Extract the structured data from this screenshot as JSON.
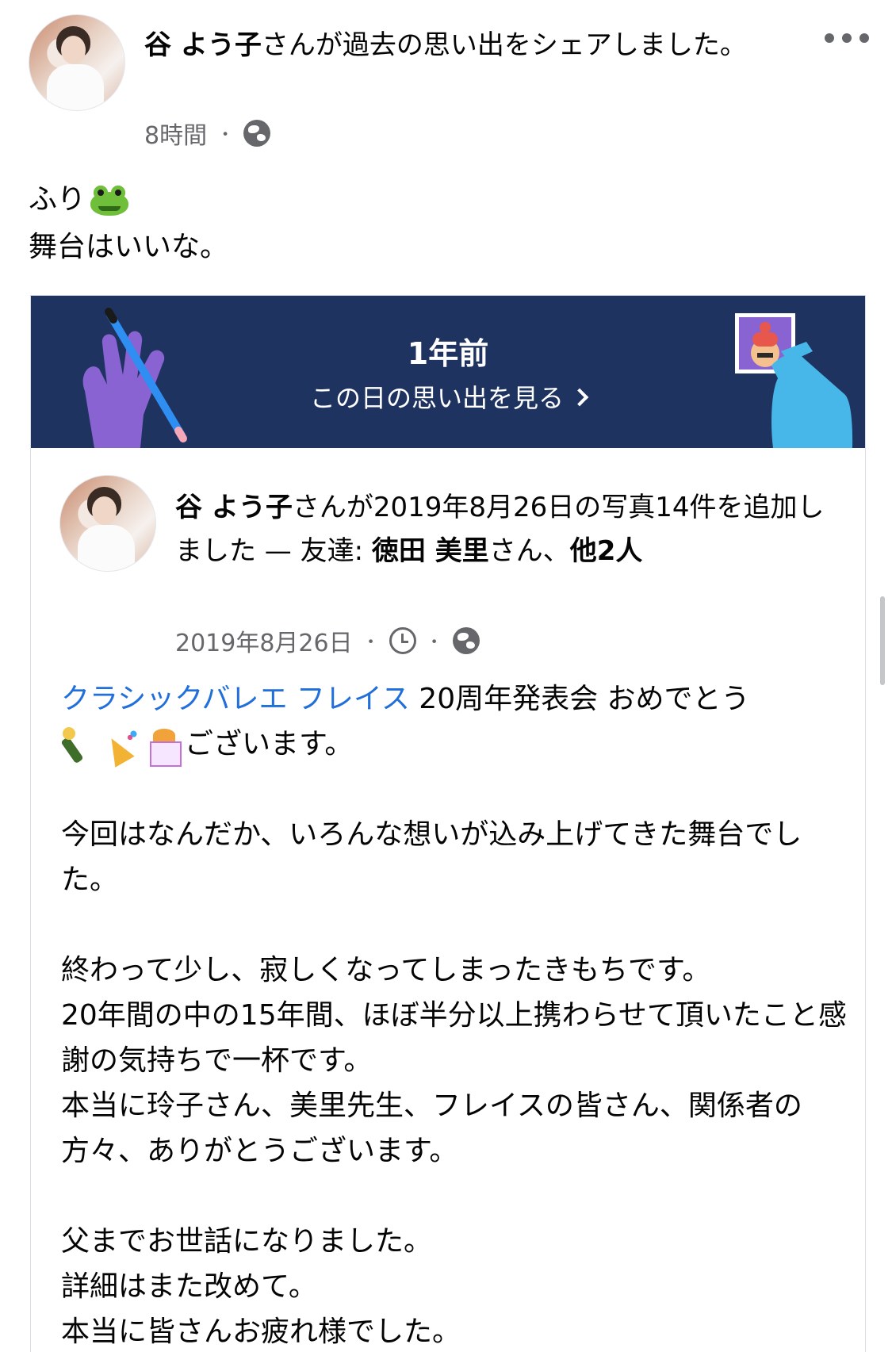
{
  "post": {
    "author": "谷 よう子",
    "action": "さんが過去の思い出をシェアしました。",
    "time": "8時間",
    "separator": "・",
    "privacy_icon": "globe-icon",
    "more_icon": "more-dots-icon",
    "status_line1": "ふり",
    "status_emoji": "frog-emoji",
    "status_line2": "舞台はいいな。"
  },
  "memory": {
    "banner_title": "1年前",
    "banner_link": "この日の思い出を見る",
    "banner_color": "#1f3361"
  },
  "shared_post": {
    "author": "谷 よう子",
    "action_a": "さんが2019年8月26日の写真14件を追加しました — 友達: ",
    "tagged": "徳田 美里",
    "action_b": "さん、",
    "others": "他2人",
    "date": "2019年8月26日",
    "separator": "・",
    "link_text": "クラシックバレエ フレイス",
    "line1_rest": " 20周年発表会 おめでとう",
    "line2_rest": "ございます。",
    "para2": "今回はなんだか、いろんな想いが込み上げてきた舞台でした。",
    "para3_l1": "終わって少し、寂しくなってしまったきもちです。",
    "para3_l2": "20年間の中の15年間、ほぼ半分以上携わらせて頂いたこと感謝の気持ちで一杯です。",
    "para3_l3": "本当に玲子さん、美里先生、フレイスの皆さん、関係者の方々、ありがとうございます。",
    "para4_l1": "父までお世話になりました。",
    "para4_l2": "詳細はまた改めて。",
    "para4_l3": "本当に皆さんお疲れ様でした。"
  },
  "colors": {
    "link": "#216fdb",
    "secondary_text": "#65676b",
    "primary_text": "#050505"
  }
}
